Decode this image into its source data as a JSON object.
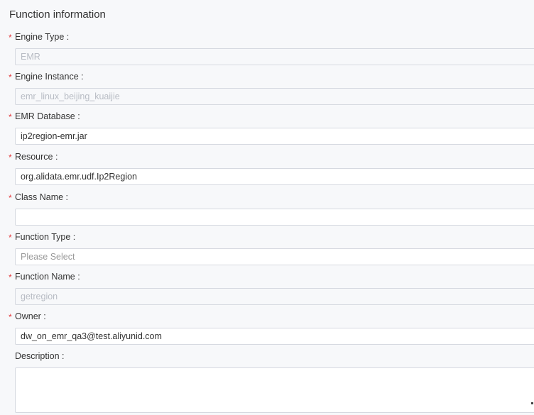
{
  "section": {
    "title": "Function information"
  },
  "fields": [
    {
      "label": "Engine Type :",
      "value": "EMR",
      "required": true,
      "state": "disabled"
    },
    {
      "label": "Engine Instance :",
      "value": "emr_linux_beijing_kuaijie",
      "required": true,
      "state": "disabled"
    },
    {
      "label": "EMR Database :",
      "value": "ip2region-emr.jar",
      "required": true,
      "state": "filled"
    },
    {
      "label": "Resource :",
      "value": "org.alidata.emr.udf.Ip2Region",
      "required": true,
      "state": "filled"
    },
    {
      "label": "Class Name :",
      "value": "",
      "required": true,
      "state": "empty"
    },
    {
      "label": "Function Type :",
      "placeholder": "Please Select",
      "required": true,
      "state": "placeholder"
    },
    {
      "label": "Function Name :",
      "value": "getregion",
      "required": true,
      "state": "disabled"
    },
    {
      "label": "Owner :",
      "value": "dw_on_emr_qa3@test.aliyunid.com",
      "required": true,
      "state": "filled"
    },
    {
      "label": "Description :",
      "value": "",
      "required": false,
      "state": "textarea"
    }
  ],
  "required_marker": "*",
  "colors": {
    "required": "#e4393c",
    "border": "#d6d9e0",
    "disabled_text": "#b8bcc4"
  }
}
